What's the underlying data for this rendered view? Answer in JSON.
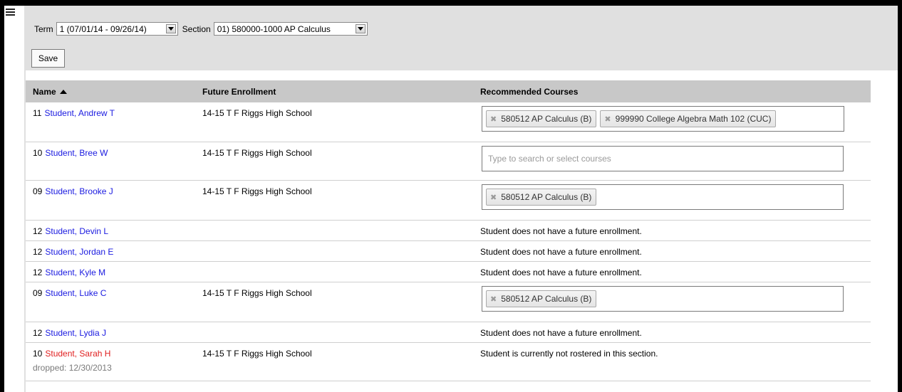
{
  "filters": {
    "term_label": "Term",
    "term_value": "1 (07/01/14 - 09/26/14)",
    "section_label": "Section",
    "section_value": "01) 580000-1000 AP Calculus"
  },
  "save_label": "Save",
  "table": {
    "columns": [
      "Name",
      "Future Enrollment",
      "Recommended Courses"
    ],
    "search_placeholder": "Type to search or select courses",
    "rows": [
      {
        "grade": "11",
        "name": "Student, Andrew T",
        "enrollment": "14-15 T F Riggs High School",
        "courses": [
          "580512 AP Calculus (B)",
          "999990 College Algebra Math 102 (CUC)"
        ]
      },
      {
        "grade": "10",
        "name": "Student, Bree W",
        "enrollment": "14-15 T F Riggs High School",
        "courses": []
      },
      {
        "grade": "09",
        "name": "Student, Brooke J",
        "enrollment": "14-15 T F Riggs High School",
        "courses": [
          "580512 AP Calculus (B)"
        ]
      },
      {
        "grade": "12",
        "name": "Student, Devin L",
        "message": "Student does not have a future enrollment."
      },
      {
        "grade": "12",
        "name": "Student, Jordan E",
        "message": "Student does not have a future enrollment."
      },
      {
        "grade": "12",
        "name": "Student, Kyle M",
        "message": "Student does not have a future enrollment."
      },
      {
        "grade": "09",
        "name": "Student, Luke C",
        "enrollment": "14-15 T F Riggs High School",
        "courses": [
          "580512 AP Calculus (B)"
        ]
      },
      {
        "grade": "12",
        "name": "Student, Lydia J",
        "message": "Student does not have a future enrollment."
      },
      {
        "grade": "10",
        "name": "Student, Sarah H",
        "enrollment": "14-15 T F Riggs High School",
        "message": "Student is currently not rostered in this section.",
        "note": "dropped: 12/30/2013"
      }
    ]
  },
  "icons": {
    "menu": "hamburger-menu-icon",
    "sort": "sort-ascending-icon",
    "remove": "remove-tag-icon",
    "dropdown": "dropdown-arrow-icon"
  },
  "colors": {
    "link": "#1a1ae0",
    "dropped_link": "#e02020",
    "header_bg": "#c8c8c8"
  }
}
